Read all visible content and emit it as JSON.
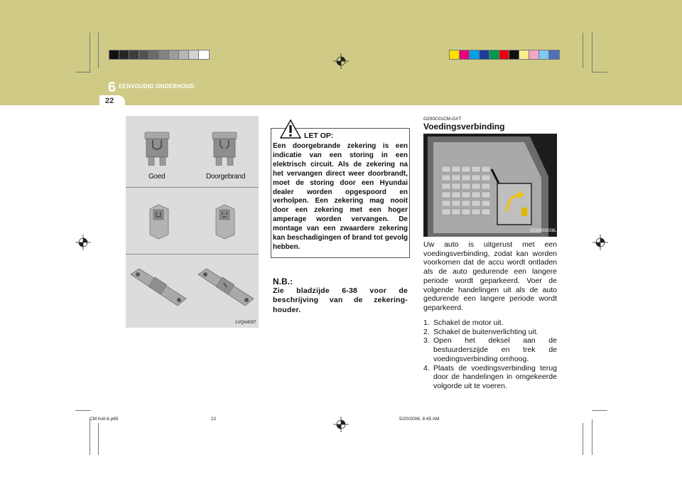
{
  "header": {
    "chapter_number": "6",
    "chapter_title": "EENVOUDIG ONDERHOUD",
    "page_number": "22",
    "band_color": "#cfcb86"
  },
  "color_bars": {
    "left": [
      "#111111",
      "#262626",
      "#3c3c3c",
      "#525252",
      "#6a6a6a",
      "#838383",
      "#9c9c9c",
      "#b7b7b7",
      "#d3d3d3",
      "#ffffff"
    ],
    "right": [
      "#ffe000",
      "#e6007e",
      "#00a0e9",
      "#1f3d99",
      "#00994d",
      "#e60012",
      "#111111",
      "#f6ee8a",
      "#f4a6c8",
      "#7fcaf0",
      "#4d70b8"
    ]
  },
  "fuse_panel": {
    "label_good": "Goed",
    "label_blown": "Doorgebrand",
    "image_code": "1VQA4037"
  },
  "warning": {
    "title": "LET OP:",
    "text": "Een doorgebrande zekering is een indicatie van een storing in een elektrisch circuit. Als de zekering na het vervangen direct weer doorbrandt, moet de storing door een Hyundai dealer worden opgespoord en verholpen. Een zekering mag nooit door een zekering met een hoger amperage worden vervangen. De montage van een zwaardere zekering kan beschadigingen of brand tot gevolg hebben."
  },
  "note": {
    "title": "N.B.:",
    "text": "Zie bladzijde 6-38 voor de beschrijving van de zekering-houder."
  },
  "section": {
    "code": "G200C01CM-GXT",
    "heading": "Voedingsverbinding",
    "image_code": "OCM055028L",
    "body": "Uw auto is uitgerust met een voedingsverbinding, zodat kan worden voorkomen dat de accu wordt ontladen als de auto gedurende een langere periode wordt geparkeerd. Voer de volgende handelingen uit als de auto gedurende een langere periode wordt geparkeerd.",
    "steps": [
      {
        "num": "1.",
        "text": "Schakel de motor uit."
      },
      {
        "num": "2.",
        "text": "Schakel de buitenverlichting uit."
      },
      {
        "num": "3.",
        "text": "Open het deksel aan de bestuurderszijde en trek de voedingsverbinding omhoog."
      },
      {
        "num": "4.",
        "text": "Plaats de voedingsverbinding terug door de handelingen in omgekeerde volgorde uit te voeren."
      }
    ]
  },
  "footer": {
    "file": "CM holl-6.p65",
    "page": "22",
    "date": "5/20/2008, 8:45 AM"
  }
}
